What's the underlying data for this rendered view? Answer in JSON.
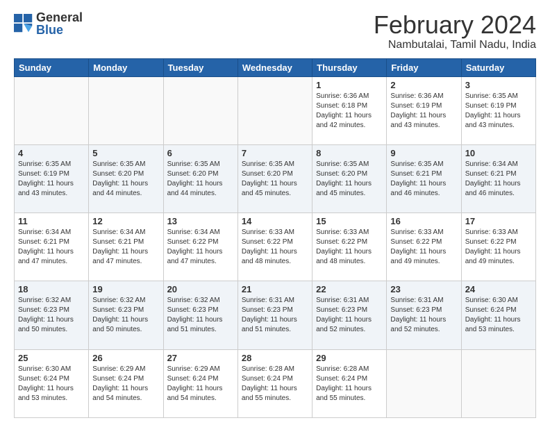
{
  "logo": {
    "general": "General",
    "blue": "Blue"
  },
  "title": "February 2024",
  "subtitle": "Nambutalai, Tamil Nadu, India",
  "days_of_week": [
    "Sunday",
    "Monday",
    "Tuesday",
    "Wednesday",
    "Thursday",
    "Friday",
    "Saturday"
  ],
  "weeks": [
    [
      {
        "day": "",
        "info": ""
      },
      {
        "day": "",
        "info": ""
      },
      {
        "day": "",
        "info": ""
      },
      {
        "day": "",
        "info": ""
      },
      {
        "day": "1",
        "info": "Sunrise: 6:36 AM\nSunset: 6:18 PM\nDaylight: 11 hours\nand 42 minutes."
      },
      {
        "day": "2",
        "info": "Sunrise: 6:36 AM\nSunset: 6:19 PM\nDaylight: 11 hours\nand 43 minutes."
      },
      {
        "day": "3",
        "info": "Sunrise: 6:35 AM\nSunset: 6:19 PM\nDaylight: 11 hours\nand 43 minutes."
      }
    ],
    [
      {
        "day": "4",
        "info": "Sunrise: 6:35 AM\nSunset: 6:19 PM\nDaylight: 11 hours\nand 43 minutes."
      },
      {
        "day": "5",
        "info": "Sunrise: 6:35 AM\nSunset: 6:20 PM\nDaylight: 11 hours\nand 44 minutes."
      },
      {
        "day": "6",
        "info": "Sunrise: 6:35 AM\nSunset: 6:20 PM\nDaylight: 11 hours\nand 44 minutes."
      },
      {
        "day": "7",
        "info": "Sunrise: 6:35 AM\nSunset: 6:20 PM\nDaylight: 11 hours\nand 45 minutes."
      },
      {
        "day": "8",
        "info": "Sunrise: 6:35 AM\nSunset: 6:20 PM\nDaylight: 11 hours\nand 45 minutes."
      },
      {
        "day": "9",
        "info": "Sunrise: 6:35 AM\nSunset: 6:21 PM\nDaylight: 11 hours\nand 46 minutes."
      },
      {
        "day": "10",
        "info": "Sunrise: 6:34 AM\nSunset: 6:21 PM\nDaylight: 11 hours\nand 46 minutes."
      }
    ],
    [
      {
        "day": "11",
        "info": "Sunrise: 6:34 AM\nSunset: 6:21 PM\nDaylight: 11 hours\nand 47 minutes."
      },
      {
        "day": "12",
        "info": "Sunrise: 6:34 AM\nSunset: 6:21 PM\nDaylight: 11 hours\nand 47 minutes."
      },
      {
        "day": "13",
        "info": "Sunrise: 6:34 AM\nSunset: 6:22 PM\nDaylight: 11 hours\nand 47 minutes."
      },
      {
        "day": "14",
        "info": "Sunrise: 6:33 AM\nSunset: 6:22 PM\nDaylight: 11 hours\nand 48 minutes."
      },
      {
        "day": "15",
        "info": "Sunrise: 6:33 AM\nSunset: 6:22 PM\nDaylight: 11 hours\nand 48 minutes."
      },
      {
        "day": "16",
        "info": "Sunrise: 6:33 AM\nSunset: 6:22 PM\nDaylight: 11 hours\nand 49 minutes."
      },
      {
        "day": "17",
        "info": "Sunrise: 6:33 AM\nSunset: 6:22 PM\nDaylight: 11 hours\nand 49 minutes."
      }
    ],
    [
      {
        "day": "18",
        "info": "Sunrise: 6:32 AM\nSunset: 6:23 PM\nDaylight: 11 hours\nand 50 minutes."
      },
      {
        "day": "19",
        "info": "Sunrise: 6:32 AM\nSunset: 6:23 PM\nDaylight: 11 hours\nand 50 minutes."
      },
      {
        "day": "20",
        "info": "Sunrise: 6:32 AM\nSunset: 6:23 PM\nDaylight: 11 hours\nand 51 minutes."
      },
      {
        "day": "21",
        "info": "Sunrise: 6:31 AM\nSunset: 6:23 PM\nDaylight: 11 hours\nand 51 minutes."
      },
      {
        "day": "22",
        "info": "Sunrise: 6:31 AM\nSunset: 6:23 PM\nDaylight: 11 hours\nand 52 minutes."
      },
      {
        "day": "23",
        "info": "Sunrise: 6:31 AM\nSunset: 6:23 PM\nDaylight: 11 hours\nand 52 minutes."
      },
      {
        "day": "24",
        "info": "Sunrise: 6:30 AM\nSunset: 6:24 PM\nDaylight: 11 hours\nand 53 minutes."
      }
    ],
    [
      {
        "day": "25",
        "info": "Sunrise: 6:30 AM\nSunset: 6:24 PM\nDaylight: 11 hours\nand 53 minutes."
      },
      {
        "day": "26",
        "info": "Sunrise: 6:29 AM\nSunset: 6:24 PM\nDaylight: 11 hours\nand 54 minutes."
      },
      {
        "day": "27",
        "info": "Sunrise: 6:29 AM\nSunset: 6:24 PM\nDaylight: 11 hours\nand 54 minutes."
      },
      {
        "day": "28",
        "info": "Sunrise: 6:28 AM\nSunset: 6:24 PM\nDaylight: 11 hours\nand 55 minutes."
      },
      {
        "day": "29",
        "info": "Sunrise: 6:28 AM\nSunset: 6:24 PM\nDaylight: 11 hours\nand 55 minutes."
      },
      {
        "day": "",
        "info": ""
      },
      {
        "day": "",
        "info": ""
      }
    ]
  ],
  "accent_color": "#2563a8"
}
